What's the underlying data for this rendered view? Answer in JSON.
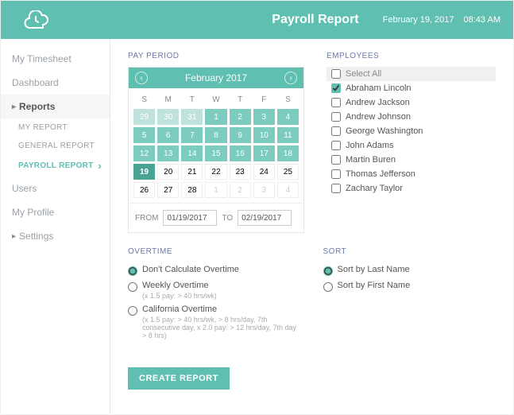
{
  "header": {
    "title": "Payroll Report",
    "date": "February 19,  2017",
    "time": "08:43 AM"
  },
  "sidebar": {
    "items": [
      "My Timesheet",
      "Dashboard",
      "Reports",
      "Users",
      "My Profile",
      "Settings"
    ],
    "reports_sub": [
      "MY REPORT",
      "GENERAL REPORT",
      "PAYROLL REPORT"
    ]
  },
  "labels": {
    "pay_period": "PAY PERIOD",
    "employees": "EMPLOYEES",
    "overtime": "OVERTIME",
    "sort": "SORT",
    "from": "FROM",
    "to": "TO",
    "select_all": "Select All",
    "create": "CREATE REPORT"
  },
  "calendar": {
    "month": "February 2017",
    "dow": [
      "S",
      "M",
      "T",
      "W",
      "T",
      "F",
      "S"
    ],
    "cells": [
      {
        "n": "29",
        "c": "fade"
      },
      {
        "n": "30",
        "c": "fade"
      },
      {
        "n": "31",
        "c": "fade"
      },
      {
        "n": "1",
        "c": "in"
      },
      {
        "n": "2",
        "c": "in"
      },
      {
        "n": "3",
        "c": "in"
      },
      {
        "n": "4",
        "c": "in"
      },
      {
        "n": "5",
        "c": "in"
      },
      {
        "n": "6",
        "c": "in"
      },
      {
        "n": "7",
        "c": "in"
      },
      {
        "n": "8",
        "c": "in"
      },
      {
        "n": "9",
        "c": "in"
      },
      {
        "n": "10",
        "c": "in"
      },
      {
        "n": "11",
        "c": "in"
      },
      {
        "n": "12",
        "c": "in"
      },
      {
        "n": "13",
        "c": "in"
      },
      {
        "n": "14",
        "c": "in"
      },
      {
        "n": "15",
        "c": "in"
      },
      {
        "n": "16",
        "c": "in"
      },
      {
        "n": "17",
        "c": "in"
      },
      {
        "n": "18",
        "c": "in"
      },
      {
        "n": "19",
        "c": "cur"
      },
      {
        "n": "20",
        "c": ""
      },
      {
        "n": "21",
        "c": ""
      },
      {
        "n": "22",
        "c": ""
      },
      {
        "n": "23",
        "c": ""
      },
      {
        "n": "24",
        "c": ""
      },
      {
        "n": "25",
        "c": ""
      },
      {
        "n": "26",
        "c": ""
      },
      {
        "n": "27",
        "c": ""
      },
      {
        "n": "28",
        "c": ""
      },
      {
        "n": "1",
        "c": "out"
      },
      {
        "n": "2",
        "c": "out"
      },
      {
        "n": "3",
        "c": "out"
      },
      {
        "n": "4",
        "c": "out"
      }
    ],
    "from": "01/19/2017",
    "to": "02/19/2017"
  },
  "employees": [
    {
      "name": "Abraham Lincoln",
      "checked": true
    },
    {
      "name": "Andrew Jackson",
      "checked": false
    },
    {
      "name": "Andrew Johnson",
      "checked": false
    },
    {
      "name": "George Washington",
      "checked": false
    },
    {
      "name": "John Adams",
      "checked": false
    },
    {
      "name": "Martin Buren",
      "checked": false
    },
    {
      "name": "Thomas Jefferson",
      "checked": false
    },
    {
      "name": "Zachary Taylor",
      "checked": false
    }
  ],
  "overtime": [
    {
      "label": "Don't Calculate Overtime",
      "sub": "",
      "checked": true
    },
    {
      "label": "Weekly Overtime",
      "sub": "(x 1.5 pay: > 40 hrs/wk)",
      "checked": false
    },
    {
      "label": "California Overtime",
      "sub": "(x 1.5 pay: > 40 hrs/wk, > 8 hrs/day, 7th consecutive day, x 2.0 pay: > 12 hrs/day, 7th day > 8 hrs)",
      "checked": false
    }
  ],
  "sort": [
    {
      "label": "Sort by Last Name",
      "checked": true
    },
    {
      "label": "Sort by First Name",
      "checked": false
    }
  ]
}
